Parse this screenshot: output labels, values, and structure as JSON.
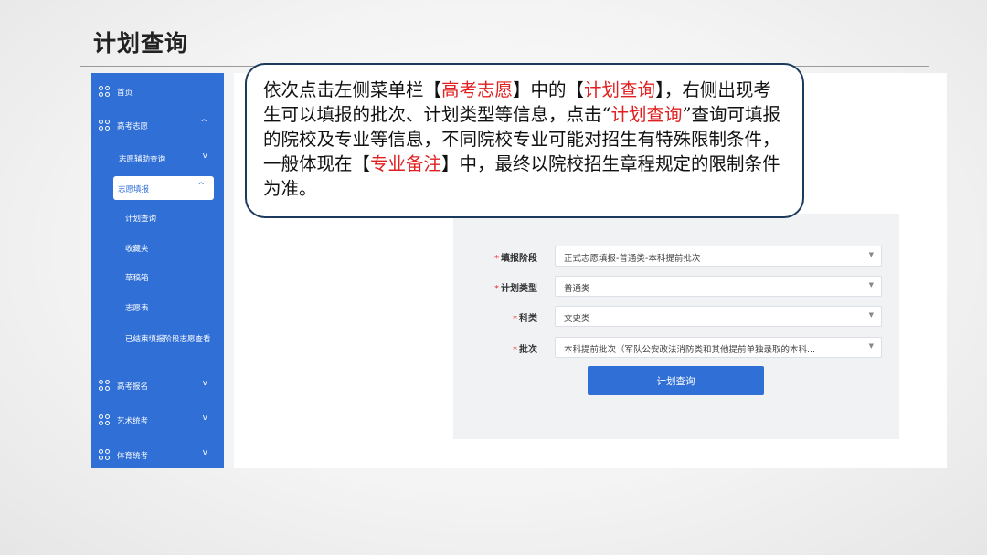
{
  "slide": {
    "title": "计划查询"
  },
  "sidebar": {
    "items": [
      {
        "label": "首页"
      },
      {
        "label": "高考志愿",
        "chevron": "^"
      },
      {
        "label": "志愿辅助查询",
        "chevron": "v"
      },
      {
        "label": "志愿填报",
        "chevron": "^"
      },
      {
        "label": "计划查询"
      },
      {
        "label": "收藏夹"
      },
      {
        "label": "草稿箱"
      },
      {
        "label": "志愿表"
      },
      {
        "label": "已结束填报阶段志愿查看"
      },
      {
        "label": "高考报名",
        "chevron": "v"
      },
      {
        "label": "艺术统考",
        "chevron": "v"
      },
      {
        "label": "体育统考",
        "chevron": "v"
      }
    ]
  },
  "callout": {
    "segments": [
      "依次点击左侧菜单栏【",
      "高考志愿",
      "】中的【",
      "计划查询",
      "】，右侧出现考生可以填报的批次、计划类型等信息，点击“",
      "计划查询",
      "”查询可填报的院校及专业等信息，不同院校专业可能对招生有特殊限制条件，一般体现在【",
      "专业备注",
      "】中，最终以院校招生章程规定的限制条件为准。"
    ],
    "highlight_color": "#e02020"
  },
  "form": {
    "required_mark": "*",
    "fields": [
      {
        "label": "填报阶段",
        "value": "正式志愿填报-普通类-本科提前批次"
      },
      {
        "label": "计划类型",
        "value": "普通类"
      },
      {
        "label": "科类",
        "value": "文史类"
      },
      {
        "label": "批次",
        "value": "本科提前批次（军队公安政法消防类和其他提前单独录取的本科..."
      }
    ],
    "select_arrow": "▼",
    "submit_label": "计划查询"
  },
  "colors": {
    "sidebar": "#2f6fd6",
    "accent": "#2f6fd6",
    "required": "#e33333"
  }
}
